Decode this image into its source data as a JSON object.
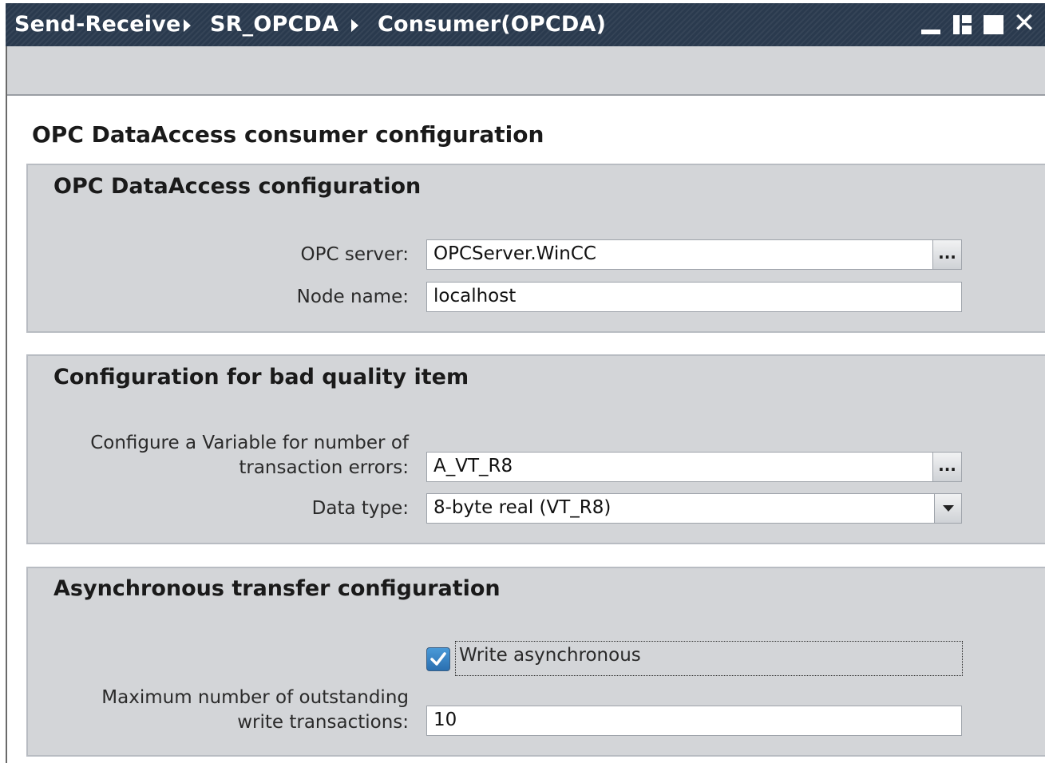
{
  "titlebar": {
    "breadcrumbs": [
      "Send-Receive",
      "SR_OPCDA",
      "Consumer(OPCDA)"
    ],
    "separator_icon": "triangle-right-icon",
    "buttons": [
      "minimize-icon",
      "float-icon",
      "maximize-icon",
      "close-icon"
    ],
    "close_glyph": "✕",
    "background_color": "#2a3a4e"
  },
  "page": {
    "title": "OPC DataAccess consumer configuration"
  },
  "sections": {
    "opc_da": {
      "title": "OPC DataAccess configuration",
      "server_label": "OPC server:",
      "server_value": "OPCServer.WinCC",
      "node_label": "Node name:",
      "node_value": "localhost",
      "browse_glyph": "..."
    },
    "bad_quality": {
      "title": "Configuration for bad quality item",
      "variable_label_line1": "Configure a Variable for number of",
      "variable_label_line2": "transaction errors:",
      "variable_value": "A_VT_R8",
      "datatype_label": "Data type:",
      "datatype_value": "8-byte real (VT_R8)",
      "browse_glyph": "..."
    },
    "async": {
      "title": "Asynchronous transfer configuration",
      "write_async_label": "Write asynchronous",
      "write_async_checked": true,
      "max_label_line1": "Maximum number of outstanding",
      "max_label_line2": "write transactions:",
      "max_value": "10"
    }
  },
  "colors": {
    "panel": "#d3d5d8",
    "checkbox_accent": "#2a6fb0"
  }
}
